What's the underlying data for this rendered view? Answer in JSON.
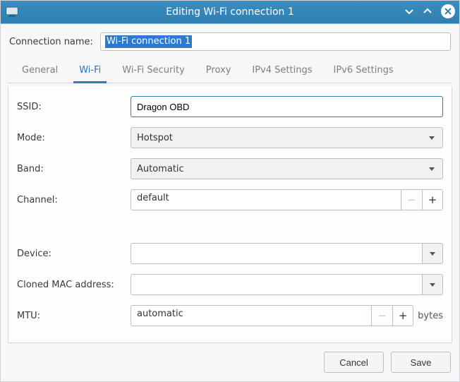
{
  "window": {
    "title": "Editing Wi-Fi connection 1"
  },
  "connection_name": {
    "label": "Connection name:",
    "value": "Wi-Fi connection 1"
  },
  "tabs": {
    "general": "General",
    "wifi": "Wi-Fi",
    "wifi_security": "Wi-Fi Security",
    "proxy": "Proxy",
    "ipv4": "IPv4 Settings",
    "ipv6": "IPv6 Settings"
  },
  "form": {
    "ssid": {
      "label": "SSID:",
      "value": "Dragon OBD"
    },
    "mode": {
      "label": "Mode:",
      "value": "Hotspot"
    },
    "band": {
      "label": "Band:",
      "value": "Automatic"
    },
    "channel": {
      "label": "Channel:",
      "value": "default"
    },
    "device": {
      "label": "Device:",
      "value": ""
    },
    "cloned_mac": {
      "label": "Cloned MAC address:",
      "value": ""
    },
    "mtu": {
      "label": "MTU:",
      "value": "automatic",
      "suffix": "bytes"
    }
  },
  "buttons": {
    "cancel": "Cancel",
    "save": "Save"
  }
}
